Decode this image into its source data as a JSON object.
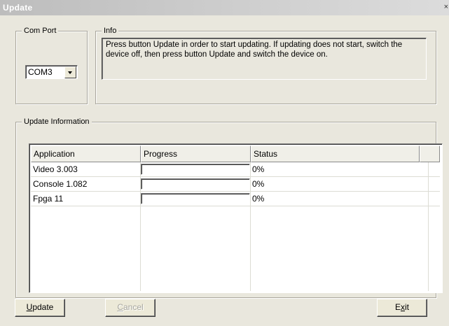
{
  "window": {
    "title": "Update",
    "close_glyph": "×"
  },
  "com_port": {
    "label": "Com Port",
    "selected": "COM3"
  },
  "info": {
    "label": "Info",
    "text": "Press button Update in order to start updating. If updating does not start, switch the device off, then press button Update and switch the device on."
  },
  "update_information": {
    "label": "Update Information",
    "columns": [
      "Application",
      "Progress",
      "Status"
    ],
    "rows": [
      {
        "application": "Video  3.003",
        "progress": 0,
        "status": "0%"
      },
      {
        "application": "Console  1.082",
        "progress": 0,
        "status": "0%"
      },
      {
        "application": "Fpga 11",
        "progress": 0,
        "status": "0%"
      }
    ]
  },
  "buttons": {
    "update": {
      "accel": "U",
      "rest": "pdate",
      "enabled": true
    },
    "cancel": {
      "accel": "C",
      "rest": "ancel",
      "enabled": false
    },
    "exit": {
      "pre": "E",
      "accel": "x",
      "rest": "it",
      "enabled": true
    }
  },
  "colors": {
    "title_bar": "#c4c4c4",
    "window_bg": "#e9e7dd",
    "progress_fill": "#316ac5",
    "disabled_text": "#a7a69e"
  }
}
